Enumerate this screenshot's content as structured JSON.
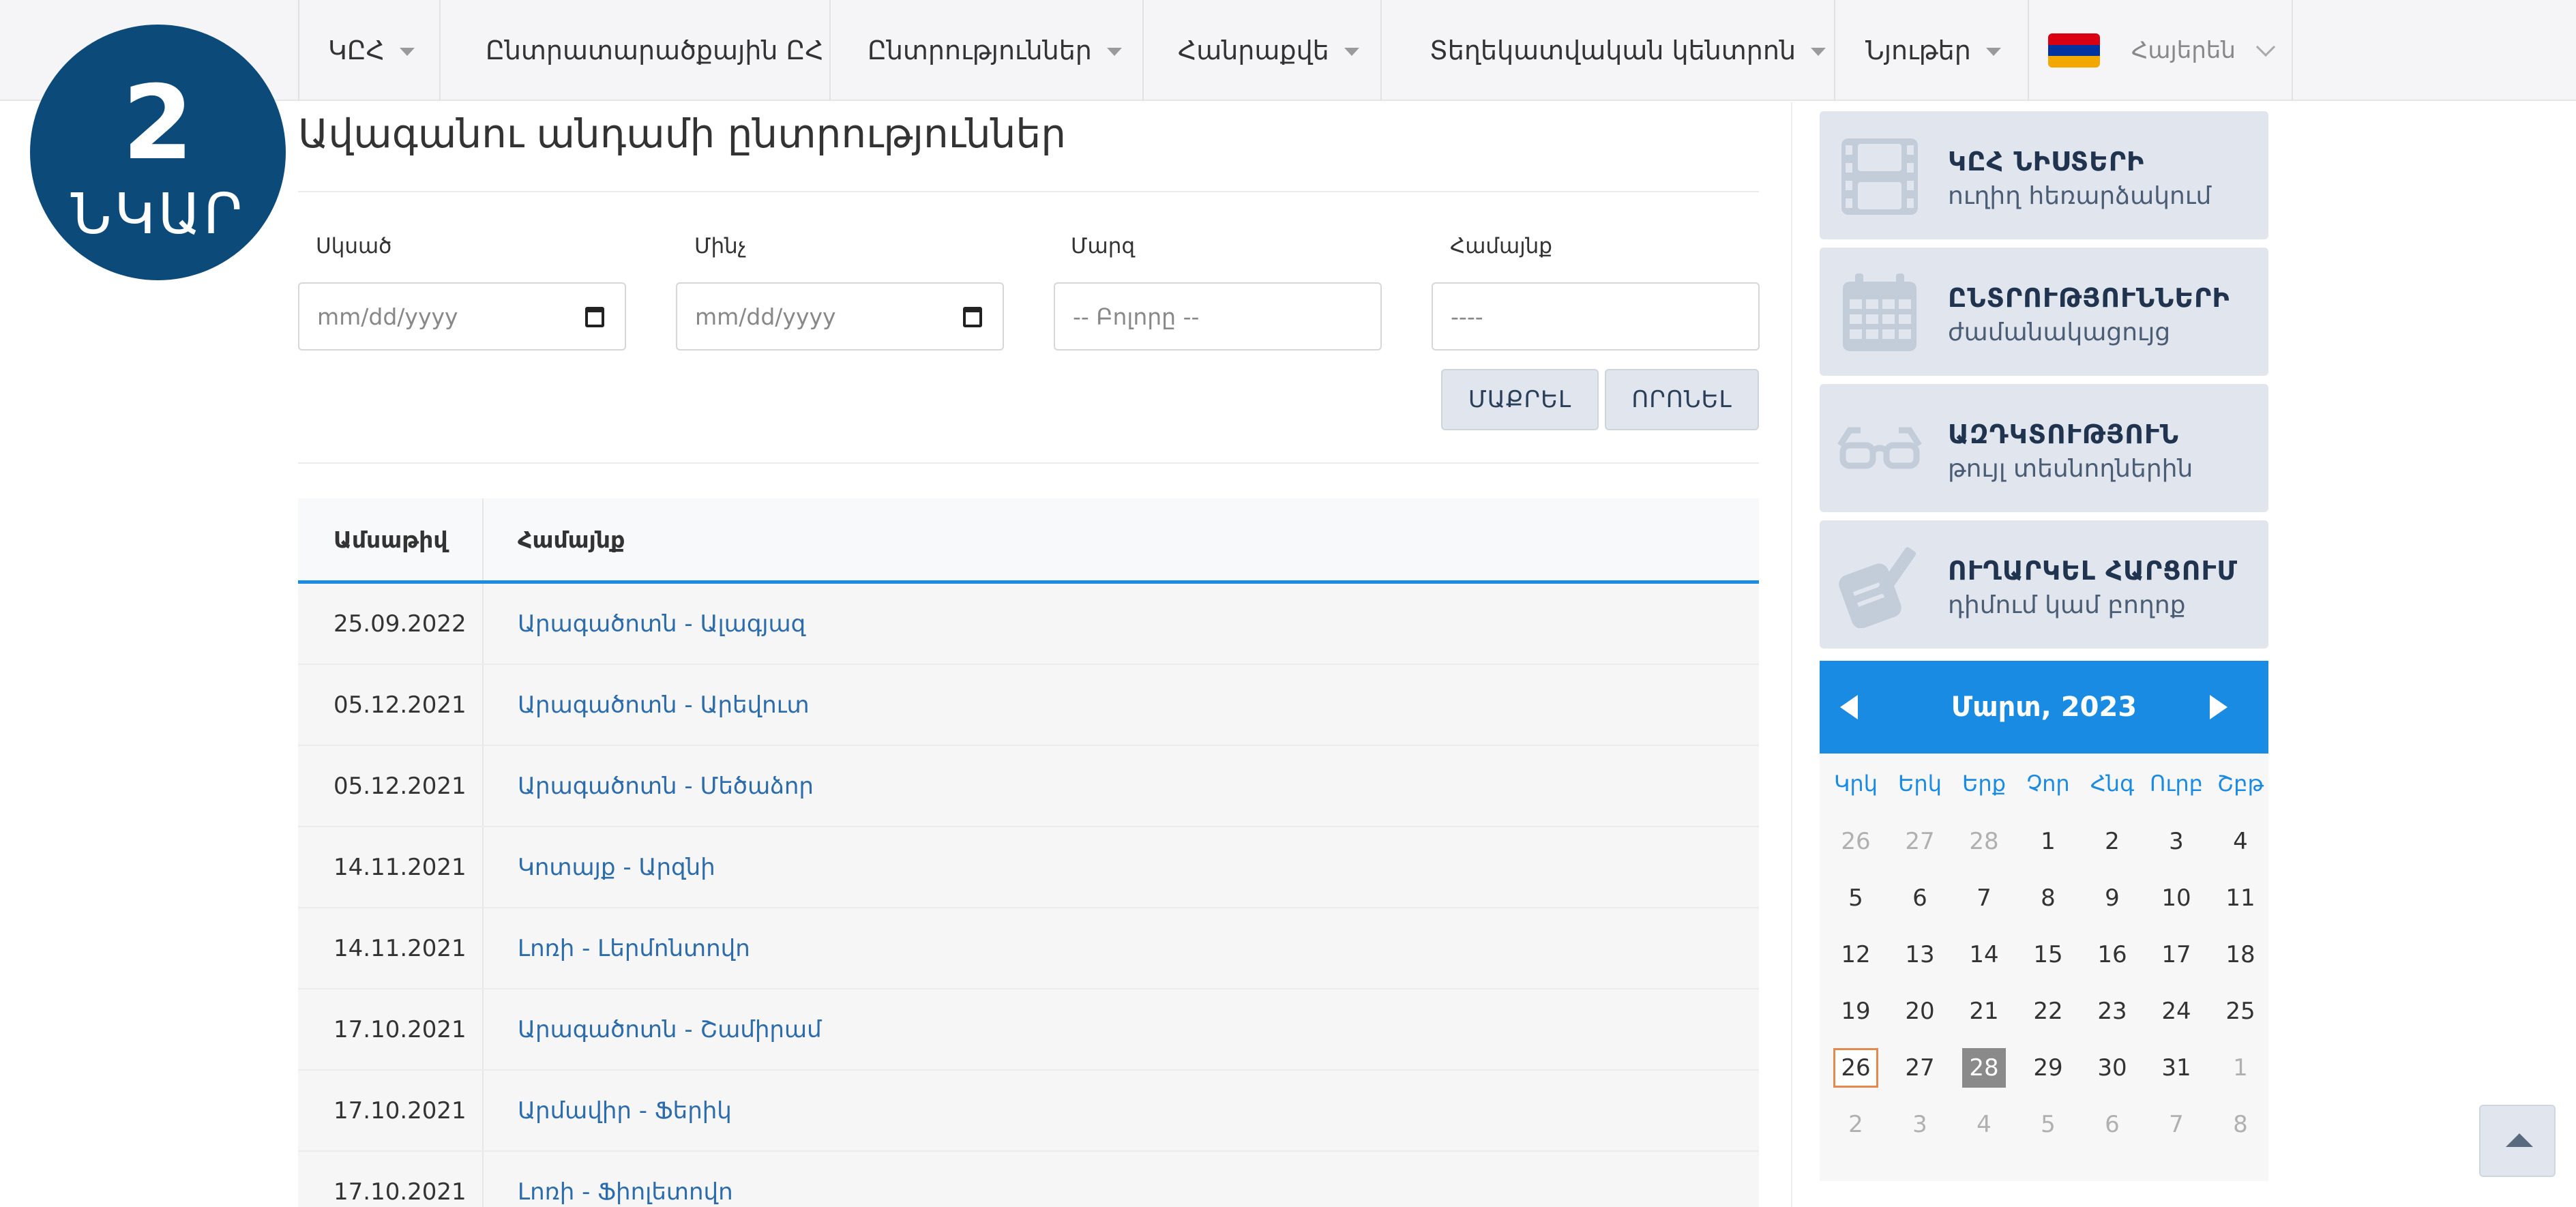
{
  "badge": {
    "number": "2",
    "word": "ՆԿԱՐ"
  },
  "nav": {
    "items": [
      {
        "label": "ԿԸՀ",
        "dropdown": true
      },
      {
        "label": "Ընտրատարածքային ԸՀ",
        "dropdown": false
      },
      {
        "label": "Ընտրություններ",
        "dropdown": true
      },
      {
        "label": "Հանրաքվե",
        "dropdown": true
      },
      {
        "label": "Տեղեկատվական կենտրոն",
        "dropdown": true
      },
      {
        "label": "Նյութեր",
        "dropdown": true
      }
    ],
    "language": "Հայերեն",
    "flag_colors": [
      "#d90012",
      "#0033a0",
      "#f2a800"
    ]
  },
  "main": {
    "title": "Ավագանու անդամի ընտրություններ",
    "filters": {
      "from_label": "Սկսած",
      "from_placeholder": "mm/dd/yyyy",
      "to_label": "Մինչ",
      "to_placeholder": "mm/dd/yyyy",
      "region_label": "Մարզ",
      "region_value": "-- Բոլորը --",
      "community_label": "Համայնք",
      "community_value": "----"
    },
    "buttons": {
      "clear": "ՄԱՔՐԵԼ",
      "filter": "ՈՐՈՆԵԼ"
    },
    "table": {
      "headers": [
        "Ամսաթիվ",
        "Համայնք"
      ],
      "rows": [
        {
          "date": "25.09.2022",
          "community": "Արագածոտն - Ալագյազ"
        },
        {
          "date": "05.12.2021",
          "community": "Արագածոտն - Արեվուտ"
        },
        {
          "date": "05.12.2021",
          "community": "Արագածոտն - Մեծաձոր"
        },
        {
          "date": "14.11.2021",
          "community": "Կոտայք - Արզնի"
        },
        {
          "date": "14.11.2021",
          "community": "Լոռի - Լերմոնտովո"
        },
        {
          "date": "17.10.2021",
          "community": "Արագածոտն - Շամիրամ"
        },
        {
          "date": "17.10.2021",
          "community": "Արմավիր - Ֆերիկ"
        },
        {
          "date": "17.10.2021",
          "community": "Լոռի - Ֆիոլետովո"
        }
      ]
    }
  },
  "sidebar": {
    "cards": [
      {
        "title": "ԿԸՀ ՆԻՍՏԵՐԻ",
        "subtitle": "ուղիղ հեռարձակում",
        "icon": "film-icon"
      },
      {
        "title": "ԸՆՏՐՈՒԹՅՈՒՆՆԵՐԻ",
        "subtitle": "ժամանակացույց",
        "icon": "calendar-icon"
      },
      {
        "title": "ԱԶԴԿՏՈՒԹՅՈՒՆ",
        "subtitle": "թույլ տեսնողներին",
        "icon": "glasses-icon"
      },
      {
        "title": "ՈՒՂԱՐԿԵԼ ՀԱՐՑՈՒՄ",
        "subtitle": "դիմում կամ բողոք",
        "icon": "pencil-paper-icon"
      }
    ],
    "calendar": {
      "month_label": "Մարտ, 2023",
      "weekdays": [
        "Կրկ",
        "Երկ",
        "Երք",
        "Չոր",
        "Հնգ",
        "Ուրբ",
        "Շբթ"
      ],
      "weeks": [
        [
          "26",
          "27",
          "28",
          "1",
          "2",
          "3",
          "4"
        ],
        [
          "5",
          "6",
          "7",
          "8",
          "9",
          "10",
          "11"
        ],
        [
          "12",
          "13",
          "14",
          "15",
          "16",
          "17",
          "18"
        ],
        [
          "19",
          "20",
          "21",
          "22",
          "23",
          "24",
          "25"
        ],
        [
          "26",
          "27",
          "28",
          "29",
          "30",
          "31",
          "1"
        ],
        [
          "2",
          "3",
          "4",
          "5",
          "6",
          "7",
          "8"
        ]
      ],
      "today": "26",
      "selected": "28",
      "accent_color": "#1a8be3",
      "today_border_color": "#e38a4e"
    }
  }
}
